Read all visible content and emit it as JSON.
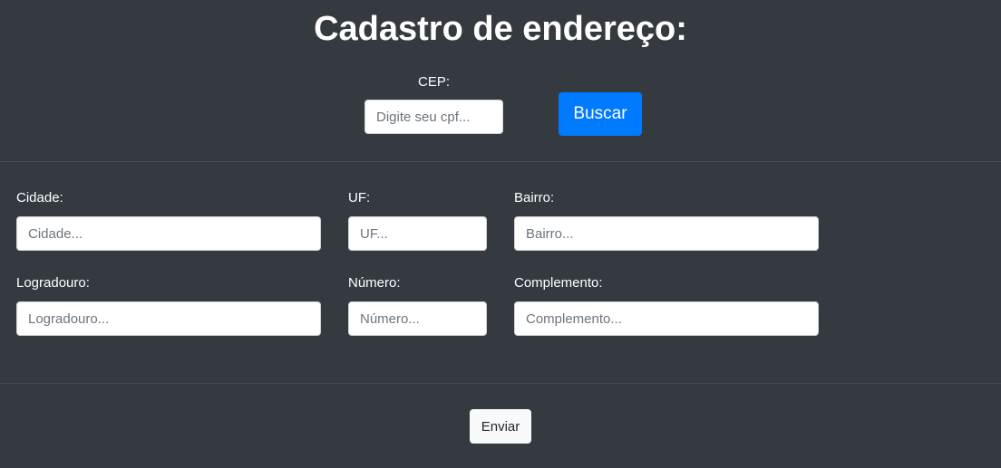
{
  "header": {
    "title": "Cadastro de endereço:"
  },
  "search": {
    "cep_label": "CEP:",
    "cep_placeholder": "Digite seu cpf...",
    "cep_value": "",
    "button_label": "Buscar"
  },
  "form": {
    "cidade": {
      "label": "Cidade:",
      "placeholder": "Cidade...",
      "value": ""
    },
    "uf": {
      "label": "UF:",
      "placeholder": "UF...",
      "value": ""
    },
    "bairro": {
      "label": "Bairro:",
      "placeholder": "Bairro...",
      "value": ""
    },
    "logradouro": {
      "label": "Logradouro:",
      "placeholder": "Logradouro...",
      "value": ""
    },
    "numero": {
      "label": "Número:",
      "placeholder": "Número...",
      "value": ""
    },
    "complemento": {
      "label": "Complemento:",
      "placeholder": "Complemento...",
      "value": ""
    }
  },
  "footer": {
    "submit_label": "Enviar"
  },
  "colors": {
    "background": "#343a40",
    "primary": "#007bff",
    "light_button": "#f8f9fa",
    "text": "#ffffff"
  }
}
